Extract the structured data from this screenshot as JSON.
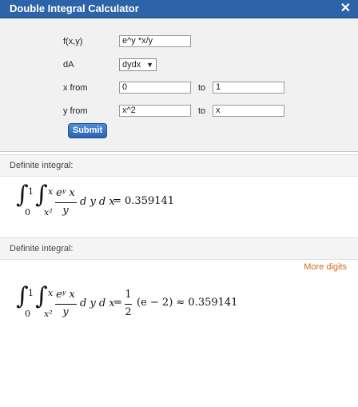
{
  "window": {
    "title": "Double Integral Calculator",
    "close_glyph": "✕"
  },
  "form": {
    "fxy_label": "f(x,y)",
    "fxy_value": "e^y *x/y",
    "dA_label": "dA",
    "dA_selected": "dydx",
    "x_from_label": "x from",
    "x_from_value": "0",
    "x_to_label": "to",
    "x_to_value": "1",
    "y_from_label": "y from",
    "y_from_value": "x^2",
    "y_to_label": "to",
    "y_to_value": "x",
    "submit_label": "Submit"
  },
  "result1": {
    "header": "Definite integral:",
    "outer_lower": "0",
    "outer_upper": "1",
    "inner_lower": "x²",
    "inner_upper": "x",
    "numerator": "eʸ x",
    "denominator": "y",
    "differentials": "d y d x",
    "rhs": "= 0.359141"
  },
  "result2": {
    "header": "Definite integral:",
    "more_digits": "More digits",
    "outer_lower": "0",
    "outer_upper": "1",
    "inner_lower": "x²",
    "inner_upper": "x",
    "numerator": "eʸ x",
    "denominator": "y",
    "differentials": "d y d x",
    "equals": "=",
    "frac_num": "1",
    "frac_den": "2",
    "rhs": "(e − 2) ≈ 0.359141"
  },
  "colors": {
    "titlebar": "#2d63a8",
    "submit": "#2b63b0",
    "more_digits": "#d06a22"
  }
}
